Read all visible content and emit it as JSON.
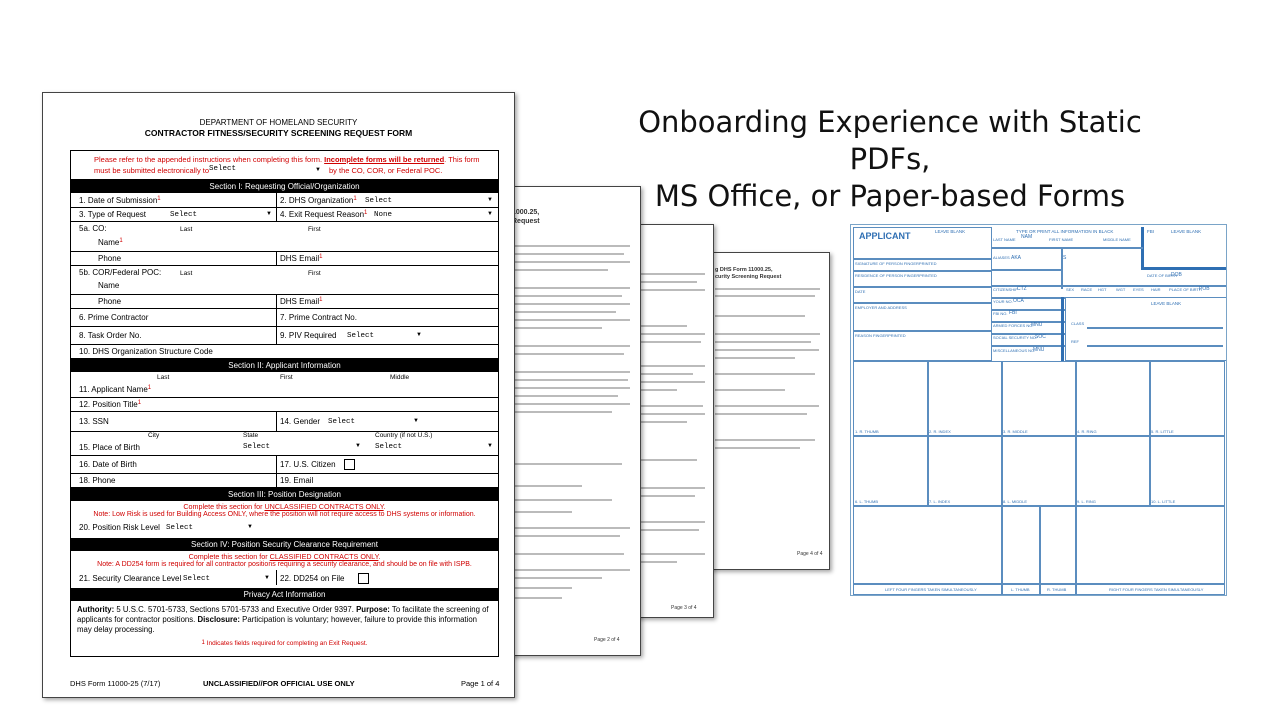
{
  "slide": {
    "title_line1": "Onboarding Experience with Static PDFs,",
    "title_line2": "MS Office, or Paper-based Forms"
  },
  "form": {
    "agency": "DEPARTMENT OF HOMELAND SECURITY",
    "title": "CONTRACTOR FITNESS/SECURITY SCREENING REQUEST FORM",
    "notice_1": "Please refer to the appended instructions when completing this form.",
    "notice_returned": "Incomplete forms will be returned",
    "notice_2": ". This form",
    "notice_3": "must be submitted electronically to",
    "notice_4": "by the CO, COR, or Federal POC.",
    "select_placeholder": "Select",
    "none_value": "None",
    "section1": "Section I: Requesting Official/Organization",
    "f1": "1.   Date of Submission",
    "f2": "2.   DHS Organization",
    "f3": "3.   Type of Request",
    "f4": "4.   Exit Request Reason",
    "f5a": "5a.  CO:",
    "f5b": "5b.  COR/Federal POC:",
    "last": "Last",
    "first": "First",
    "middle": "Middle",
    "name": "Name",
    "phone": "Phone",
    "dhs_email": "DHS Email",
    "f6": "6.   Prime Contractor",
    "f7": "7. Prime Contract No.",
    "f8": "8.   Task Order No.",
    "f9": "9.   PIV Required",
    "f10": "10. DHS Organization Structure Code",
    "section2": "Section II: Applicant Information",
    "f11": "11. Applicant Name",
    "f12": "12. Position Title",
    "f13": "13. SSN",
    "f14": "14. Gender",
    "city": "City",
    "state": "State",
    "country": "Country (if not U.S.)",
    "f15": "15. Place of Birth",
    "f16": "16. Date of Birth",
    "f17": "17. U.S. Citizen",
    "f18": "18. Phone",
    "f19": "19. Email",
    "section3": "Section III: Position Designation",
    "s3_note1a": "Complete this section for ",
    "s3_note1b": "UNCLASSIFIED CONTRACTS ONLY",
    "s3_note1c": ".",
    "s3_note2": "Note: Low Risk is used for Building Access ONLY, where the position will not require access to DHS systems or information.",
    "f20": "20. Position Risk Level",
    "section4": "Section IV: Position Security Clearance Requirement",
    "s4_note1a": "Complete this section for ",
    "s4_note1b": "CLASSIFIED CONTRACTS ONLY",
    "s4_note1c": ".",
    "s4_note2": "Note: A DD254 form is required for all contractor positions requiring a security clearance, and should be on file with ISPB.",
    "f21": "21. Security Clearance Level",
    "f22": "22.   DD254 on File",
    "privacy_header": "Privacy Act Information",
    "privacy_authority_label": "Authority:",
    "privacy_authority": " 5 U.S.C. 5701-5733, Sections 5701-5733 and Executive Order 9397. ",
    "privacy_purpose_label": "Purpose:",
    "privacy_purpose": " To facilitate the screening of applicants for  contractor positions. ",
    "privacy_disclosure_label": "Disclosure:",
    "privacy_disclosure": " Participation is voluntary; however, failure to provide this information may delay processing.",
    "exit_footnote": "Indicates fields required for completing an Exit Request.",
    "footer_form": "DHS Form 11000-25 (7/17)",
    "footer_class": "UNCLASSIFIED//FOR OFFICIAL USE ONLY",
    "footer_page": "Page 1 of 4"
  },
  "back_pages": {
    "page2_label": "Page 2 of 4",
    "page3_label": "Page 3 of 4",
    "page4_label": "Page 4 of 4",
    "page2_heading_a": "1000.25,",
    "page2_heading_b": "Request",
    "page4_heading_a": "g DHS Form 11000.25,",
    "page4_heading_b": "curity Screening Request"
  },
  "fingerprint_card": {
    "applicant": "APPLICANT",
    "leave_blank_1": "LEAVE BLANK",
    "type_or_print": "TYPE OR PRINT ALL INFORMATION IN BLACK",
    "fbi": "FBI",
    "leave_blank_2": "LEAVE BLANK",
    "last_name": "LAST NAME",
    "nam": "NAM",
    "first_name": "FIRST NAME",
    "middle_name": "MIDDLE NAME",
    "aliases": "ALIASES",
    "aka": "AKA",
    "citizenship": "CITIZENSHIP",
    "ctz": "CTZ",
    "your_no": "YOUR NO.",
    "oca": "OCA",
    "fbi_no": "FBI NO.",
    "fbi_val": "FBI",
    "armed_forces": "ARMED FORCES NO.",
    "mnu": "MNU",
    "social_security": "SOCIAL SECURITY NO.",
    "soc": "SOC",
    "misc_no": "MISCELLANEOUS NO.",
    "mnu2": "MNU",
    "dob": "DOB",
    "pob": "POB",
    "leave_blank_3": "LEAVE BLANK",
    "class": "CLASS",
    "ref": "REF",
    "sex": "SEX",
    "race": "RACE",
    "hgt": "HGT",
    "wgt": "WGT",
    "eyes": "EYES",
    "hair": "HAIR",
    "place_of_birth": "PLACE OF BIRTH",
    "date": "DATE",
    "employer": "EMPLOYER AND ADDRESS",
    "reason": "REASON FINGERPRINTED",
    "fingers_top": [
      "1. R. THUMB",
      "2. R. INDEX",
      "3. R. MIDDLE",
      "4. R. RING",
      "5. R. LITTLE"
    ],
    "fingers_bottom": [
      "6. L. THUMB",
      "7. L. INDEX",
      "8. L. MIDDLE",
      "9. L. RING",
      "10. L. LITTLE"
    ],
    "left_four": "LEFT FOUR FINGERS TAKEN SIMULTANEOUSLY",
    "l_thumb": "L. THUMB",
    "r_thumb": "R. THUMB",
    "right_four": "RIGHT FOUR FINGERS TAKEN SIMULTANEOUSLY"
  }
}
